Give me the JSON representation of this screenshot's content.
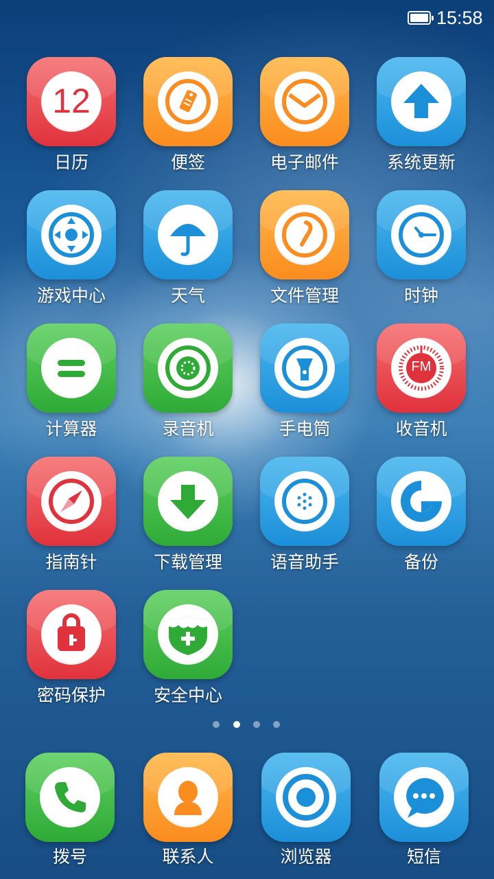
{
  "status": {
    "time": "15:58"
  },
  "apps": [
    {
      "label": "日历",
      "calendar_day": "12"
    },
    {
      "label": "便签"
    },
    {
      "label": "电子邮件"
    },
    {
      "label": "系统更新"
    },
    {
      "label": "游戏中心"
    },
    {
      "label": "天气"
    },
    {
      "label": "文件管理"
    },
    {
      "label": "时钟"
    },
    {
      "label": "计算器"
    },
    {
      "label": "录音机"
    },
    {
      "label": "手电筒"
    },
    {
      "label": "收音机",
      "badge": "FM"
    },
    {
      "label": "指南针"
    },
    {
      "label": "下载管理"
    },
    {
      "label": "语音助手"
    },
    {
      "label": "备份"
    },
    {
      "label": "密码保护"
    },
    {
      "label": "安全中心"
    }
  ],
  "page_indicator": {
    "pages": 4,
    "current": 2
  },
  "dock": [
    {
      "label": "拨号"
    },
    {
      "label": "联系人"
    },
    {
      "label": "浏览器"
    },
    {
      "label": "短信"
    }
  ],
  "colors": {
    "red": "#e0323d",
    "orange": "#fb8c1f",
    "blue": "#1c8fd9",
    "green": "#2faa37"
  }
}
